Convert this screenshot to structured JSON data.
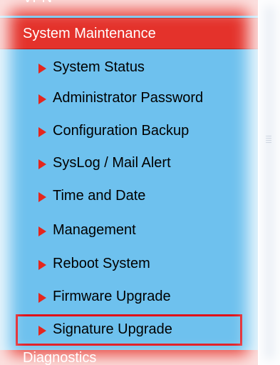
{
  "menu": {
    "top_cut_label": "VPN",
    "section_title": "System Maintenance",
    "items": [
      {
        "label": "System Status"
      },
      {
        "label": "Administrator Password"
      },
      {
        "label": "Configuration Backup"
      },
      {
        "label": "SysLog / Mail Alert"
      },
      {
        "label": "Time and Date"
      },
      {
        "label": "Management"
      },
      {
        "label": "Reboot System"
      },
      {
        "label": "Firmware Upgrade"
      },
      {
        "label": "Signature Upgrade"
      }
    ],
    "highlighted_item": "Signature Upgrade",
    "bottom_cut_label": "Diagnostics"
  },
  "colors": {
    "panel_bg": "#6ec1ee",
    "header_bg": "#e4322b",
    "arrow": "#e4261e",
    "highlight_border": "#e0121a"
  },
  "icons": {
    "item_bullet": "triangle-right-icon",
    "scroll_grip": "grip-lines-icon"
  }
}
